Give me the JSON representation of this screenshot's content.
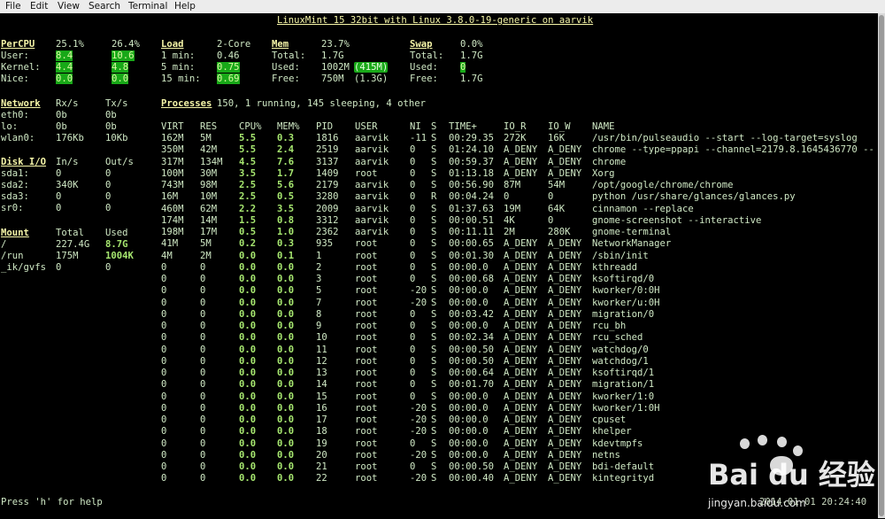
{
  "menubar": {
    "items": [
      "File",
      "Edit",
      "View",
      "Search",
      "Terminal",
      "Help"
    ]
  },
  "title": "LinuxMint 15 32bit with Linux 3.8.0-19-generic on aarvik",
  "cpu": {
    "header": "PerCPU",
    "col1": "25.1%",
    "col2": "26.4%",
    "rows": [
      {
        "label": "User:",
        "v1": "8.4",
        "v2": "10.6"
      },
      {
        "label": "Kernel:",
        "v1": "4.4",
        "v2": "4.8"
      },
      {
        "label": "Nice:",
        "v1": "0.0",
        "v2": "0.0"
      }
    ]
  },
  "load": {
    "header": "Load",
    "cores": "2-Core",
    "rows": [
      {
        "label": "1 min:",
        "value": "0.46"
      },
      {
        "label": "5 min:",
        "value": "0.75"
      },
      {
        "label": "15 min:",
        "value": "0.69"
      }
    ]
  },
  "mem": {
    "header": "Mem",
    "percent": "23.7%",
    "rows": [
      {
        "label": "Total:",
        "value": "1.7G",
        "extra": ""
      },
      {
        "label": "Used:",
        "value": "1002M",
        "extra": "(415M)"
      },
      {
        "label": "Free:",
        "value": "750M",
        "extra": "(1.3G)"
      }
    ]
  },
  "swap": {
    "header": "Swap",
    "percent": "0.0%",
    "rows": [
      {
        "label": "Total:",
        "value": "1.7G"
      },
      {
        "label": "Used:",
        "value": "0"
      },
      {
        "label": "Free:",
        "value": "1.7G"
      }
    ]
  },
  "network": {
    "header": "Network",
    "rx": "Rx/s",
    "tx": "Tx/s",
    "rows": [
      {
        "name": "eth0:",
        "rx": "0b",
        "tx": "0b"
      },
      {
        "name": "lo:",
        "rx": "0b",
        "tx": "0b"
      },
      {
        "name": "wlan0:",
        "rx": "176Kb",
        "tx": "10Kb"
      }
    ]
  },
  "disk": {
    "header": "Disk I/O",
    "in": "In/s",
    "out": "Out/s",
    "rows": [
      {
        "name": "sda1:",
        "in": "0",
        "out": "0"
      },
      {
        "name": "sda2:",
        "in": "340K",
        "out": "0"
      },
      {
        "name": "sda3:",
        "in": "0",
        "out": "0"
      },
      {
        "name": "sr0:",
        "in": "0",
        "out": "0"
      }
    ]
  },
  "mount": {
    "header": "Mount",
    "total": "Total",
    "used": "Used",
    "rows": [
      {
        "name": "/",
        "total": "227.4G",
        "used": "8.7G"
      },
      {
        "name": "/run",
        "total": "175M",
        "used": "1004K"
      },
      {
        "name": "_ik/gvfs",
        "total": "0",
        "used": "0"
      }
    ]
  },
  "processes": {
    "header": "Processes",
    "summary": "150, 1 running, 145 sleeping, 4 other",
    "columns": [
      "VIRT",
      "RES",
      "CPU%",
      "MEM%",
      "PID",
      "USER",
      "NI",
      "S",
      "TIME+",
      "IO_R",
      "IO_W",
      "NAME"
    ],
    "rows": [
      [
        "162M",
        "5M",
        "5.5",
        "0.3",
        "1816",
        "aarvik",
        "-11",
        "S",
        "00:29.35",
        "272K",
        "16K",
        "/usr/bin/pulseaudio --start --log-target=syslog"
      ],
      [
        "350M",
        "42M",
        "5.5",
        "2.4",
        "2519",
        "aarvik",
        "0",
        "S",
        "01:24.10",
        "A_DENY",
        "A_DENY",
        "chrome --type=ppapi --channel=2179.8.1645436770 --"
      ],
      [
        "317M",
        "134M",
        "4.5",
        "7.6",
        "3137",
        "aarvik",
        "0",
        "S",
        "00:59.37",
        "A_DENY",
        "A_DENY",
        "chrome"
      ],
      [
        "100M",
        "30M",
        "3.5",
        "1.7",
        "1409",
        "root",
        "0",
        "S",
        "01:13.18",
        "A_DENY",
        "A_DENY",
        "Xorg"
      ],
      [
        "743M",
        "98M",
        "2.5",
        "5.6",
        "2179",
        "aarvik",
        "0",
        "S",
        "00:56.90",
        "87M",
        "54M",
        "/opt/google/chrome/chrome"
      ],
      [
        "16M",
        "10M",
        "2.5",
        "0.5",
        "3280",
        "aarvik",
        "0",
        "R",
        "00:04.24",
        "0",
        "0",
        "python /usr/share/glances/glances.py"
      ],
      [
        "460M",
        "62M",
        "2.2",
        "3.5",
        "2009",
        "aarvik",
        "0",
        "S",
        "01:37.63",
        "19M",
        "64K",
        "cinnamon --replace"
      ],
      [
        "174M",
        "14M",
        "1.5",
        "0.8",
        "3312",
        "aarvik",
        "0",
        "S",
        "00:00.51",
        "4K",
        "0",
        "gnome-screenshot --interactive"
      ],
      [
        "198M",
        "17M",
        "0.5",
        "1.0",
        "2362",
        "aarvik",
        "0",
        "S",
        "00:11.11",
        "2M",
        "280K",
        "gnome-terminal"
      ],
      [
        "41M",
        "5M",
        "0.2",
        "0.3",
        "935",
        "root",
        "0",
        "S",
        "00:00.65",
        "A_DENY",
        "A_DENY",
        "NetworkManager"
      ],
      [
        "4M",
        "2M",
        "0.0",
        "0.1",
        "1",
        "root",
        "0",
        "S",
        "00:01.30",
        "A_DENY",
        "A_DENY",
        "/sbin/init"
      ],
      [
        "0",
        "0",
        "0.0",
        "0.0",
        "2",
        "root",
        "0",
        "S",
        "00:00.0",
        "A_DENY",
        "A_DENY",
        "kthreadd"
      ],
      [
        "0",
        "0",
        "0.0",
        "0.0",
        "3",
        "root",
        "0",
        "S",
        "00:00.68",
        "A_DENY",
        "A_DENY",
        "ksoftirqd/0"
      ],
      [
        "0",
        "0",
        "0.0",
        "0.0",
        "5",
        "root",
        "-20",
        "S",
        "00:00.0",
        "A_DENY",
        "A_DENY",
        "kworker/0:0H"
      ],
      [
        "0",
        "0",
        "0.0",
        "0.0",
        "7",
        "root",
        "-20",
        "S",
        "00:00.0",
        "A_DENY",
        "A_DENY",
        "kworker/u:0H"
      ],
      [
        "0",
        "0",
        "0.0",
        "0.0",
        "8",
        "root",
        "0",
        "S",
        "00:03.42",
        "A_DENY",
        "A_DENY",
        "migration/0"
      ],
      [
        "0",
        "0",
        "0.0",
        "0.0",
        "9",
        "root",
        "0",
        "S",
        "00:00.0",
        "A_DENY",
        "A_DENY",
        "rcu_bh"
      ],
      [
        "0",
        "0",
        "0.0",
        "0.0",
        "10",
        "root",
        "0",
        "S",
        "00:02.34",
        "A_DENY",
        "A_DENY",
        "rcu_sched"
      ],
      [
        "0",
        "0",
        "0.0",
        "0.0",
        "11",
        "root",
        "0",
        "S",
        "00:00.50",
        "A_DENY",
        "A_DENY",
        "watchdog/0"
      ],
      [
        "0",
        "0",
        "0.0",
        "0.0",
        "12",
        "root",
        "0",
        "S",
        "00:00.50",
        "A_DENY",
        "A_DENY",
        "watchdog/1"
      ],
      [
        "0",
        "0",
        "0.0",
        "0.0",
        "13",
        "root",
        "0",
        "S",
        "00:00.64",
        "A_DENY",
        "A_DENY",
        "ksoftirqd/1"
      ],
      [
        "0",
        "0",
        "0.0",
        "0.0",
        "14",
        "root",
        "0",
        "S",
        "00:01.70",
        "A_DENY",
        "A_DENY",
        "migration/1"
      ],
      [
        "0",
        "0",
        "0.0",
        "0.0",
        "15",
        "root",
        "0",
        "S",
        "00:00.0",
        "A_DENY",
        "A_DENY",
        "kworker/1:0"
      ],
      [
        "0",
        "0",
        "0.0",
        "0.0",
        "16",
        "root",
        "-20",
        "S",
        "00:00.0",
        "A_DENY",
        "A_DENY",
        "kworker/1:0H"
      ],
      [
        "0",
        "0",
        "0.0",
        "0.0",
        "17",
        "root",
        "-20",
        "S",
        "00:00.0",
        "A_DENY",
        "A_DENY",
        "cpuset"
      ],
      [
        "0",
        "0",
        "0.0",
        "0.0",
        "18",
        "root",
        "-20",
        "S",
        "00:00.0",
        "A_DENY",
        "A_DENY",
        "khelper"
      ],
      [
        "0",
        "0",
        "0.0",
        "0.0",
        "19",
        "root",
        "0",
        "S",
        "00:00.0",
        "A_DENY",
        "A_DENY",
        "kdevtmpfs"
      ],
      [
        "0",
        "0",
        "0.0",
        "0.0",
        "20",
        "root",
        "-20",
        "S",
        "00:00.0",
        "A_DENY",
        "A_DENY",
        "netns"
      ],
      [
        "0",
        "0",
        "0.0",
        "0.0",
        "21",
        "root",
        "0",
        "S",
        "00:00.50",
        "A_DENY",
        "A_DENY",
        "bdi-default"
      ],
      [
        "0",
        "0",
        "0.0",
        "0.0",
        "22",
        "root",
        "-20",
        "S",
        "00:00.40",
        "A_DENY",
        "A_DENY",
        "kintegrityd"
      ]
    ]
  },
  "footer": {
    "help": "Press 'h' for help",
    "datetime": "2014-01-01 20:24:40"
  },
  "watermark": {
    "brand": "Bai du",
    "cn": "经验",
    "url": "jingyan.baidu.com"
  },
  "colors": {
    "background": "#000000",
    "header": "#f6f6a8",
    "ok_green": "#18a818",
    "text": "#cfe8c4"
  }
}
